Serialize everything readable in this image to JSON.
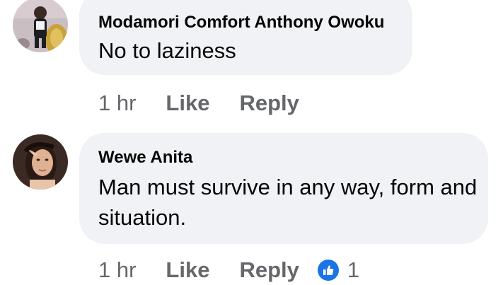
{
  "comments": [
    {
      "author": "Modamori Comfort Anthony Owoku",
      "text": "No to laziness",
      "timestamp": "1 hr",
      "like_label": "Like",
      "reply_label": "Reply"
    },
    {
      "author": "Wewe Anita",
      "text": "Man must survive in any way, form and situation.",
      "timestamp": "1 hr",
      "like_label": "Like",
      "reply_label": "Reply",
      "reaction_icon": "like-reaction-icon",
      "reaction_count": "1"
    }
  ],
  "colors": {
    "bubble": "#f0f2f5",
    "text": "#050505",
    "secondary": "#65676b",
    "like_blue": "#1b74e4"
  }
}
